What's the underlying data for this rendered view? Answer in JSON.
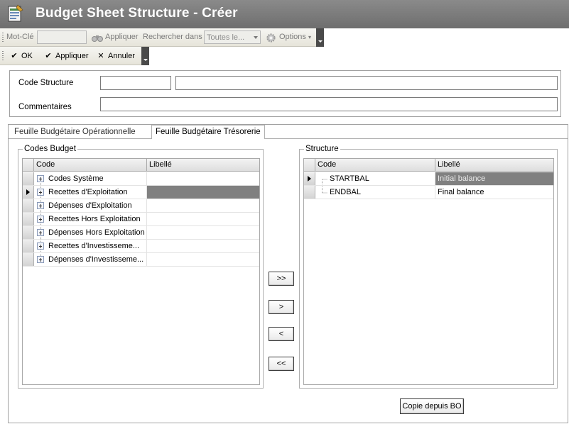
{
  "window": {
    "title": "Budget Sheet Structure - Créer"
  },
  "toolbar": {
    "keyword_label": "Mot-Clé",
    "keyword_value": "",
    "apply_search_label": "Appliquer",
    "search_in_label": "Rechercher dans",
    "search_in_value": "Toutes le...",
    "options_label": "Options"
  },
  "actions": {
    "ok": "OK",
    "apply": "Appliquer",
    "cancel": "Annuler"
  },
  "form": {
    "code_structure_label": "Code Structure",
    "code_structure_value": "",
    "code_structure_desc": "",
    "comments_label": "Commentaires",
    "comments_value": ""
  },
  "tabs": [
    {
      "label": "Feuille Budgétaire Opérationnelle",
      "active": false
    },
    {
      "label": "Feuille Budgétaire Trésorerie",
      "active": true
    }
  ],
  "codes_budget": {
    "title": "Codes Budget",
    "columns": [
      "Code",
      "Libellé"
    ],
    "rows": [
      {
        "code": "Codes Système",
        "libelle": "",
        "selected": false
      },
      {
        "code": "Recettes d'Exploitation",
        "libelle": "",
        "selected": true
      },
      {
        "code": "Dépenses d'Exploitation",
        "libelle": "",
        "selected": false
      },
      {
        "code": "Recettes Hors Exploitation",
        "libelle": "",
        "selected": false
      },
      {
        "code": "Dépenses Hors Exploitation",
        "libelle": "",
        "selected": false
      },
      {
        "code": "Recettes d'Investisseme...",
        "libelle": "",
        "selected": false
      },
      {
        "code": "Dépenses d'Investisseme...",
        "libelle": "",
        "selected": false
      }
    ]
  },
  "structure": {
    "title": "Structure",
    "columns": [
      "Code",
      "Libellé"
    ],
    "rows": [
      {
        "code": "STARTBAL",
        "libelle": "Initial balance",
        "selected": true
      },
      {
        "code": "ENDBAL",
        "libelle": "Final balance",
        "selected": false
      }
    ]
  },
  "move_buttons": {
    "add_all": ">>",
    "add": ">",
    "remove": "<",
    "remove_all": "<<"
  },
  "copy_button": "Copie depuis BO"
}
